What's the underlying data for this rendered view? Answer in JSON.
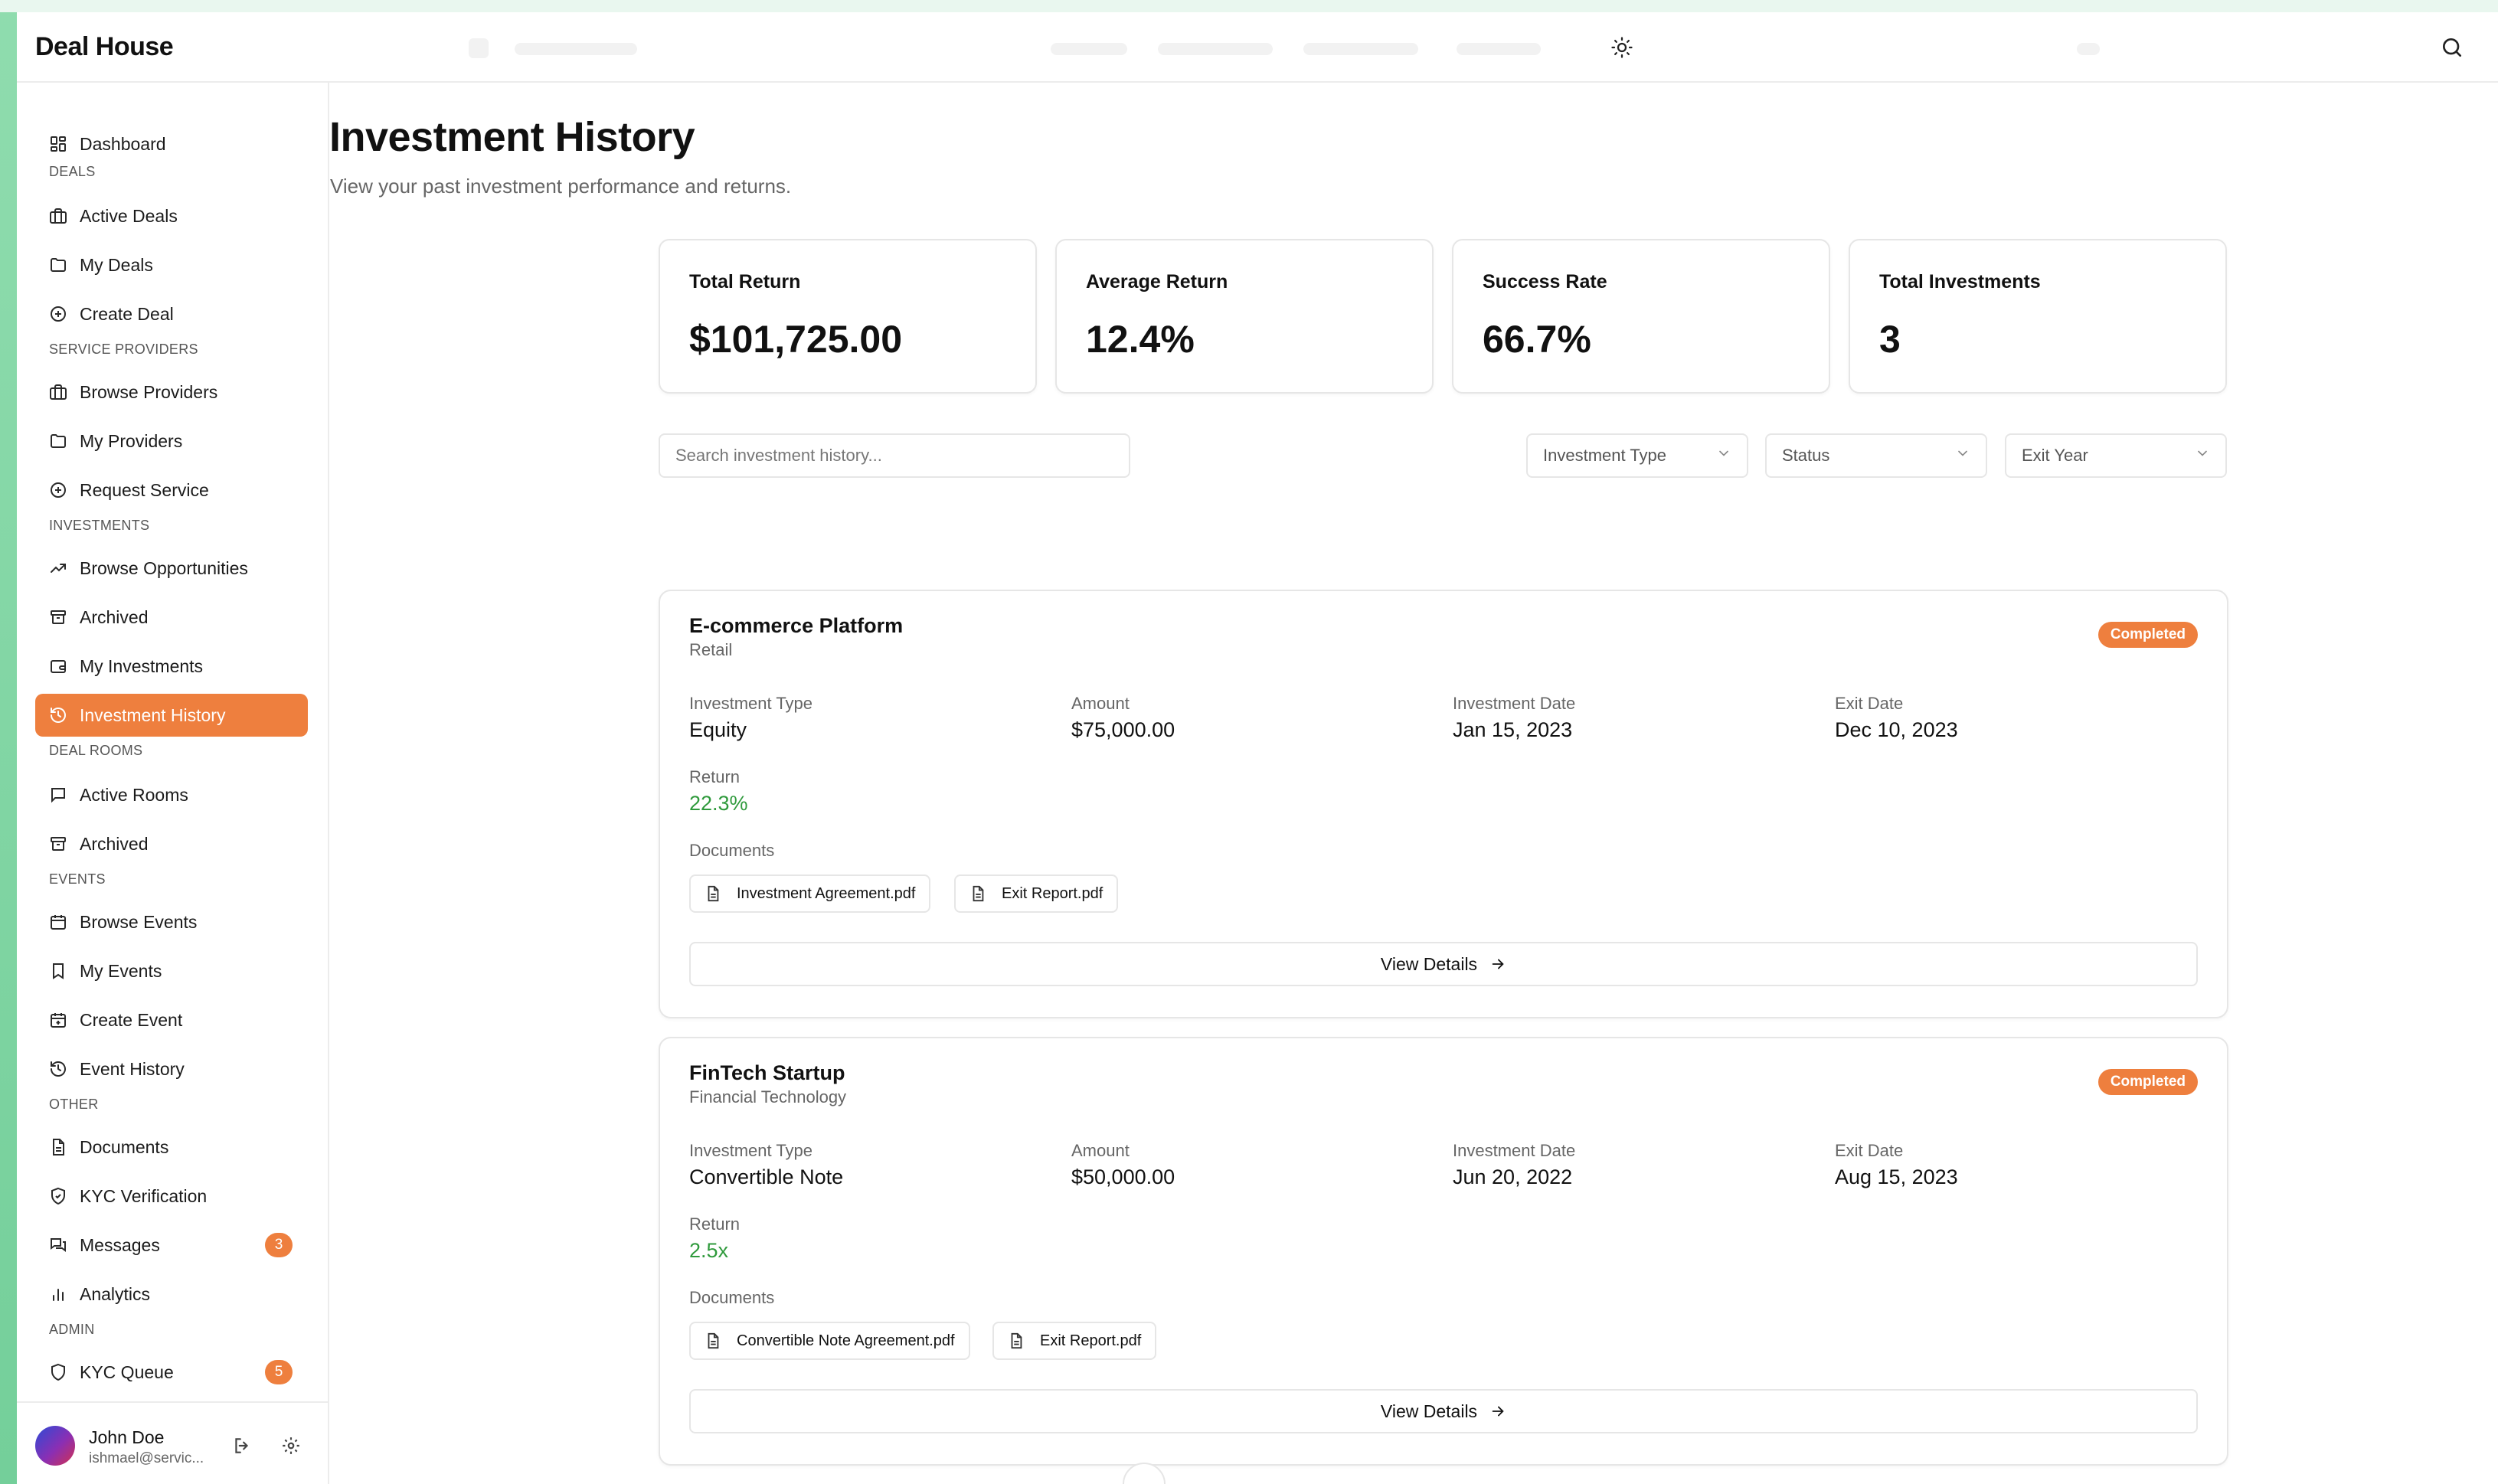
{
  "app": {
    "brand": "Deal House"
  },
  "sidebar": {
    "dashboard": "Dashboard",
    "sections": {
      "deals": "DEALS",
      "service_providers": "SERVICE PROVIDERS",
      "investments": "INVESTMENTS",
      "deal_rooms": "DEAL ROOMS",
      "events": "EVENTS",
      "other": "OTHER",
      "admin": "ADMIN"
    },
    "items": {
      "active_deals": "Active Deals",
      "my_deals": "My Deals",
      "create_deal": "Create Deal",
      "browse_providers": "Browse Providers",
      "my_providers": "My Providers",
      "request_service": "Request Service",
      "browse_opportunities": "Browse Opportunities",
      "archived_investments": "Archived",
      "my_investments": "My Investments",
      "investment_history": "Investment History",
      "active_rooms": "Active Rooms",
      "archived_rooms": "Archived",
      "browse_events": "Browse Events",
      "my_events": "My Events",
      "create_event": "Create Event",
      "event_history": "Event History",
      "documents": "Documents",
      "kyc_verification": "KYC Verification",
      "messages": "Messages",
      "analytics": "Analytics",
      "kyc_queue": "KYC Queue"
    },
    "badges": {
      "messages": "3",
      "kyc_queue": "5"
    },
    "user": {
      "name": "John Doe",
      "email": "ishmael@servic..."
    }
  },
  "page": {
    "title": "Investment History",
    "subtitle": "View your past investment performance and returns."
  },
  "stats": {
    "total_return": {
      "label": "Total Return",
      "value": "$101,725.00"
    },
    "average_return": {
      "label": "Average Return",
      "value": "12.4%"
    },
    "success_rate": {
      "label": "Success Rate",
      "value": "66.7%"
    },
    "total_investments": {
      "label": "Total Investments",
      "value": "3"
    }
  },
  "filters": {
    "search_placeholder": "Search investment history...",
    "investment_type": "Investment Type",
    "status": "Status",
    "exit_year": "Exit Year"
  },
  "labels": {
    "investment_type": "Investment Type",
    "amount": "Amount",
    "investment_date": "Investment Date",
    "exit_date": "Exit Date",
    "return": "Return",
    "documents": "Documents",
    "view_details": "View Details"
  },
  "investments": [
    {
      "name": "E-commerce Platform",
      "sector": "Retail",
      "status": "Completed",
      "type": "Equity",
      "amount": "$75,000.00",
      "investment_date": "Jan 15, 2023",
      "exit_date": "Dec 10, 2023",
      "return": "22.3%",
      "documents": [
        "Investment Agreement.pdf",
        "Exit Report.pdf"
      ]
    },
    {
      "name": "FinTech Startup",
      "sector": "Financial Technology",
      "status": "Completed",
      "type": "Convertible Note",
      "amount": "$50,000.00",
      "investment_date": "Jun 20, 2022",
      "exit_date": "Aug 15, 2023",
      "return": "2.5x",
      "documents": [
        "Convertible Note Agreement.pdf",
        "Exit Report.pdf"
      ]
    }
  ],
  "colors": {
    "accent": "#ee7f3e",
    "return_positive": "#2f9a3c",
    "edge_strip": "#7fd5a3"
  }
}
